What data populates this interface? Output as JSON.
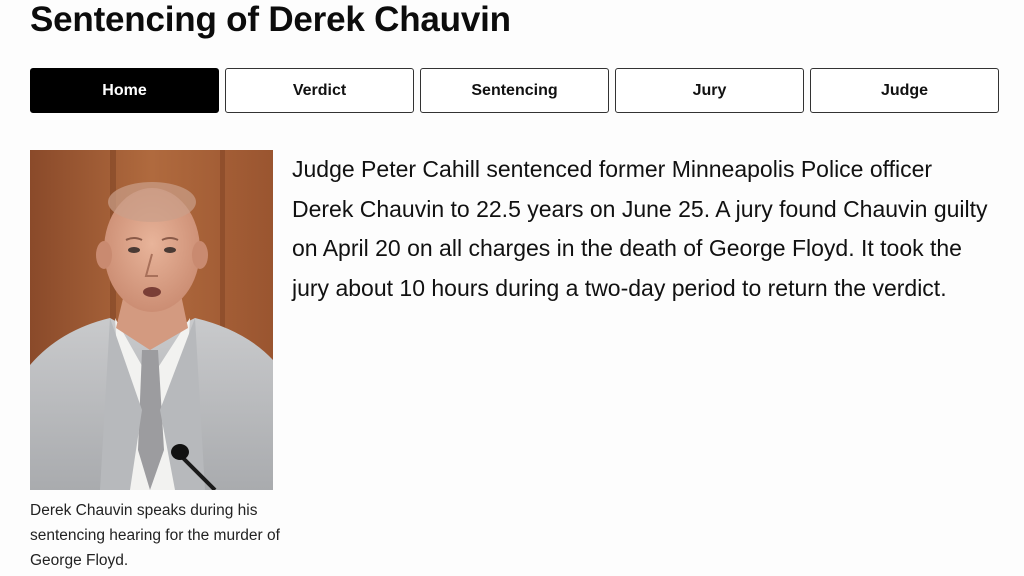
{
  "page": {
    "title": "Sentencing of Derek Chauvin"
  },
  "tabs": [
    {
      "label": "Home",
      "active": true
    },
    {
      "label": "Verdict",
      "active": false
    },
    {
      "label": "Sentencing",
      "active": false
    },
    {
      "label": "Jury",
      "active": false
    },
    {
      "label": "Judge",
      "active": false
    }
  ],
  "photo": {
    "caption": "Derek Chauvin speaks during his sentencing hearing for the murder of George Floyd."
  },
  "article": {
    "body": "Judge Peter Cahill sentenced former Minneapolis Police officer Derek Chauvin to 22.5 years on June 25. A jury found Chauvin guilty on April 20 on all charges in the death of George Floyd. It took the jury about 10 hours during a two-day period to return the verdict."
  },
  "colors": {
    "active_tab_bg": "#000000",
    "active_tab_text": "#ffffff",
    "tab_border": "#333333"
  }
}
